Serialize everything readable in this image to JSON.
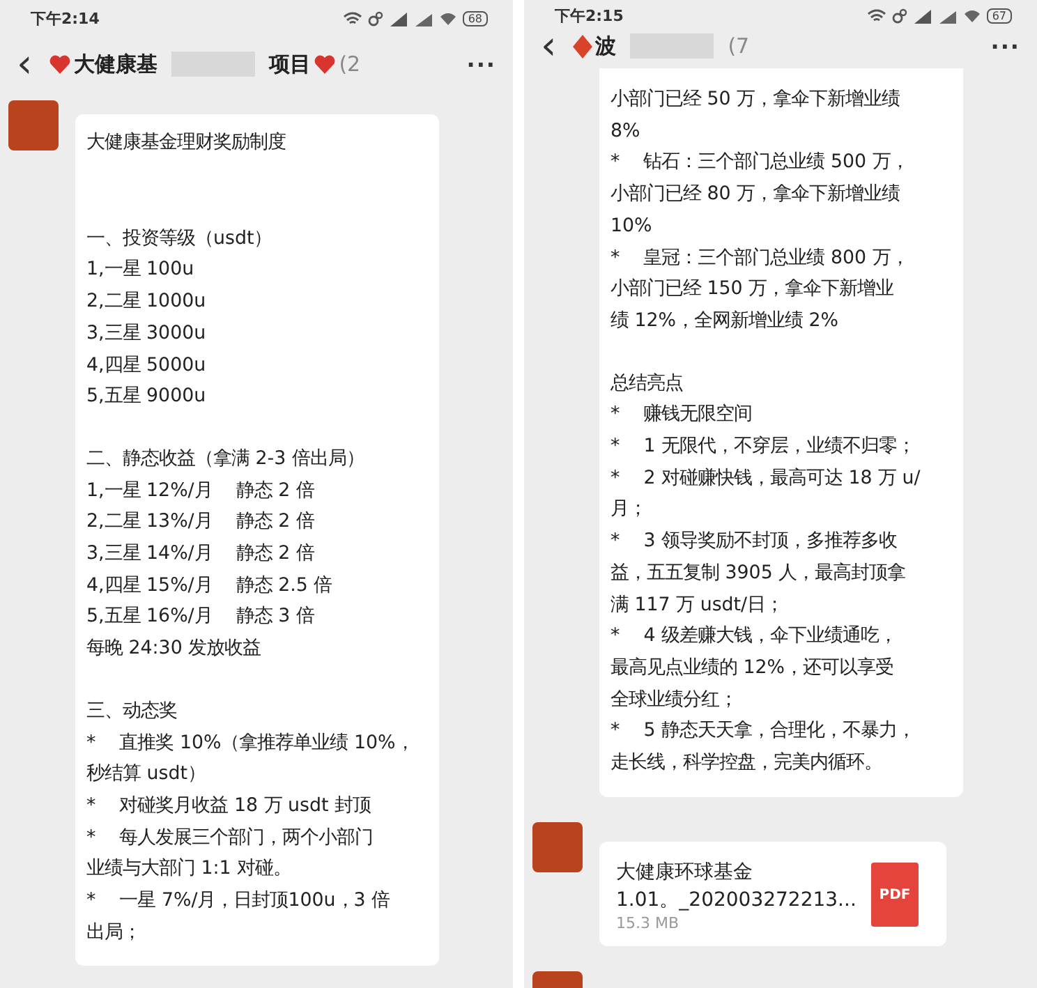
{
  "panes": [
    {
      "status_bar": {
        "time": "下午2:14",
        "battery": "68"
      },
      "header": {
        "back": "‹",
        "title_start": "大健康基",
        "title_end": "项目",
        "count": "(2",
        "more": "···"
      },
      "messages": [
        {
          "kind": "text",
          "cut_top": false,
          "sections": [
            [
              "大健康基金理财奖励制度"
            ],
            [
              "一、投资等级（usdt）",
              "1,一星 100u",
              "2,二星 1000u",
              "3,三星 3000u",
              "4,四星 5000u",
              "5,五星 9000u"
            ],
            [
              "二、静态收益（拿满 2-3 倍出局）",
              "1,一星 12%/月    静态 2 倍",
              "2,二星 13%/月    静态 2 倍",
              "3,三星 14%/月    静态 2 倍",
              "4,四星 15%/月    静态 2.5 倍",
              "5,五星 16%/月    静态 3 倍",
              "每晚 24:30 发放收益"
            ],
            [
              "三、动态奖",
              "*    直推奖 10%（拿推荐单业绩 10%，",
              "秒结算 usdt）",
              "*    对碰奖月收益 18 万 usdt 封顶",
              "*    每人发展三个部门，两个小部门",
              "业绩与大部门 1:1 对碰。",
              "*    一星 7%/月，日封顶100u，3 倍",
              "出局；"
            ]
          ]
        }
      ]
    },
    {
      "status_bar": {
        "time": "下午2:15",
        "battery": "67"
      },
      "header": {
        "back": "‹",
        "title_start": "波",
        "count": "(7",
        "more": "···"
      },
      "messages": [
        {
          "kind": "text",
          "cut_top": true,
          "sections": [
            [
              "小部门已经 50 万，拿伞下新增业绩",
              "8%",
              "*    钻石：三个部门总业绩 500 万，",
              "小部门已经 80 万，拿伞下新增业绩",
              "10%",
              "*    皇冠：三个部门总业绩 800 万，",
              "小部门已经 150 万，拿伞下新增业",
              "绩 12%，全网新增业绩 2%"
            ],
            [
              "总结亮点",
              "*    赚钱无限空间",
              "*    1 无限代，不穿层，业绩不归零；",
              "*    2 对碰赚快钱，最高可达 18 万 u/",
              "月；",
              "*    3 领导奖励不封顶，多推荐多收",
              "益，五五复制 3905 人，最高封顶拿",
              "满 117 万 usdt/日；",
              "*    4 级差赚大钱，伞下业绩通吃，",
              "最高见点业绩的 12%，还可以享受",
              "全球业绩分红；",
              "*    5 静态天天拿，合理化，不暴力，",
              "走长线，科学控盘，完美内循环。"
            ]
          ]
        },
        {
          "kind": "file",
          "name": "大健康环球基金",
          "file_name": "1.01。_202003272213...",
          "size": "15.3 MB",
          "type": "PDF"
        }
      ]
    }
  ]
}
